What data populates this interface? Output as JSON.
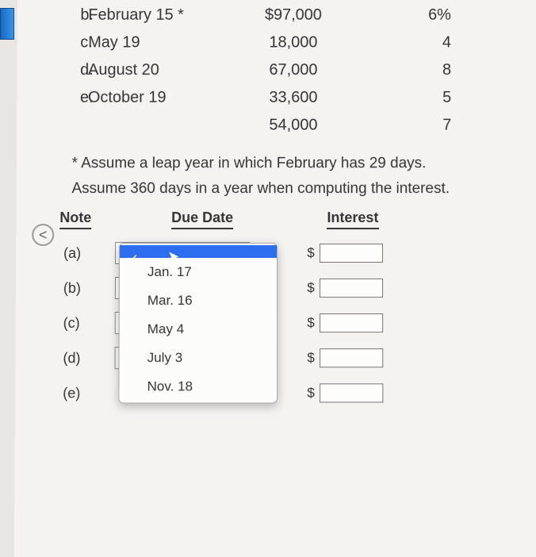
{
  "table_rows": [
    {
      "letter": "b.",
      "date": "February 15 *",
      "amount": "$97,000",
      "percent": "6%"
    },
    {
      "letter": "c.",
      "date": "May 19",
      "amount": "18,000",
      "percent": "4"
    },
    {
      "letter": "d.",
      "date": "August 20",
      "amount": "67,000",
      "percent": "8"
    },
    {
      "letter": "e.",
      "date": "October 19",
      "amount": "33,600",
      "percent": "5"
    },
    {
      "letter": "",
      "date": "",
      "amount": "54,000",
      "percent": "7"
    }
  ],
  "footnote": "* Assume a leap year in which February has 29 days.",
  "assumption": "Assume 360 days in a year when computing the interest.",
  "headers": {
    "note": "Note",
    "duedate": "Due Date",
    "interest": "Interest"
  },
  "answer_rows": [
    {
      "label": "(a)"
    },
    {
      "label": "(b)"
    },
    {
      "label": "(c)"
    },
    {
      "label": "(d)"
    },
    {
      "label": "(e)"
    }
  ],
  "dropdown_options": [
    {
      "label": "",
      "selected": true
    },
    {
      "label": "Jan. 17",
      "selected": false
    },
    {
      "label": "Mar. 16",
      "selected": false
    },
    {
      "label": "May 4",
      "selected": false
    },
    {
      "label": "July 3",
      "selected": false
    },
    {
      "label": "Nov. 18",
      "selected": false
    }
  ],
  "nav_arrow": "<",
  "dollar": "$"
}
